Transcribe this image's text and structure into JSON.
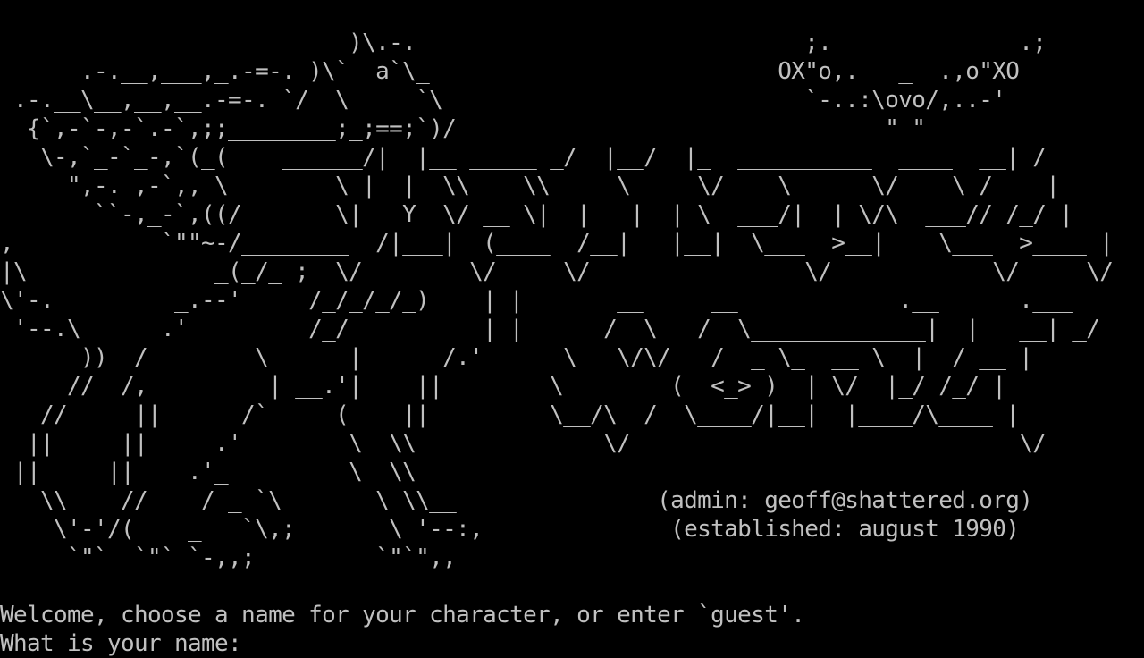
{
  "terminal": {
    "background": "#000000",
    "foreground": "#c0c0c0",
    "banner_lines": [
      "                         _)\\.-.                             ;.              .;",
      "      .-.__,___,_.-=-. )\\`  a`\\_                          OX\"o,.   _  .,o\"XO",
      " .-.__\\__,__,__.-=-. `/  \\     `\\                           `-..:\\ovo/,..-'",
      "  {`,-`-,-`.-`,;;________;_;==;`)/                                \" \"",
      "   \\-,`_-`_-,`(_(    ______/|  |__ _____ _/  |__/  |_  __________  ____  __| /",
      "     \",-._,-`,,_\\______  \\ |  |  \\\\__  \\\\   __\\   __\\/ __ \\_  __ \\/ __ \\ / __ |",
      "       ``-,_-`,((/       \\|   Y  \\/ __ \\|  |   |  | \\  ___/|  | \\/\\  ___// /_/ |",
      ",           `\"\"~-/________  /|___|  (____  /__|   |__|  \\___  >__|    \\___  >____ |",
      "|\\              _(_/_ ;  \\/        \\/     \\/                \\/            \\/     \\/",
      "\\'-.         _.--'     /_/_/_/_)    | |       __     __            .__      .___",
      " '--.\\      .'         /_/          | |      /  \\   /  \\_____________|  |   __| _/",
      "      ))  /        \\      |      /.'      \\   \\/\\/   /  _ \\_  __ \\  |  / __ |",
      "     //  /,         | __.'|    ||        \\        (  <_> )  | \\/  |_/ /_/ |",
      "   //     ||      /`     (    ||         \\__/\\  /  \\____/|__|  |____/\\____ |",
      "  ||     ||     .'        \\  \\\\              \\/                             \\/",
      " ||     ||    .'_         \\  \\\\",
      "   \\\\    //    / _ `\\       \\ \\\\__               (admin: geoff@shattered.org)",
      "    \\'-'/(    _   `\\,;       \\ '--:,              (established: august 1990)",
      "     `\"`  `\"` `-,,;         `\"`\",,"
    ],
    "welcome_text": "Welcome, choose a name for your character, or enter `guest'.",
    "prompt_text": "What is your name: ",
    "name_input_value": ""
  }
}
